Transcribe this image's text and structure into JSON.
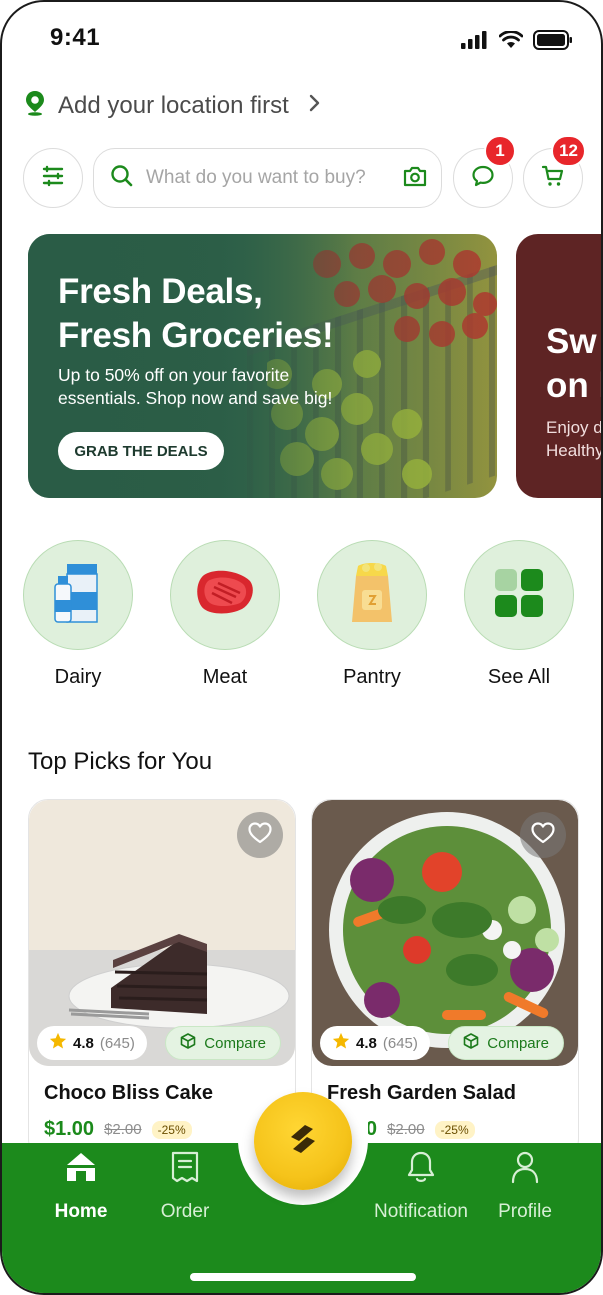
{
  "status_bar": {
    "time": "9:41"
  },
  "location": {
    "label": "Add your location first"
  },
  "search": {
    "placeholder": "What do you want to buy?"
  },
  "header": {
    "messages_badge": "1",
    "cart_badge": "12"
  },
  "banners": [
    {
      "title_line1": "Fresh Deals,",
      "title_line2": "Fresh Groceries!",
      "subtitle_line1": "Up to 50% off on your favorite",
      "subtitle_line2": "essentials. Shop now and save big!",
      "cta": "GRAB THE DEALS"
    },
    {
      "title_line1": "Sw",
      "title_line2": "on l",
      "subtitle_line1": "Enjoy d",
      "subtitle_line2": "Healthy"
    }
  ],
  "categories": [
    {
      "label": "Dairy",
      "icon": "milk-carton-icon"
    },
    {
      "label": "Meat",
      "icon": "steak-icon"
    },
    {
      "label": "Pantry",
      "icon": "flour-bag-icon"
    },
    {
      "label": "See All",
      "icon": "grid-icon"
    }
  ],
  "section_title": "Top Picks for You",
  "products": [
    {
      "name": "Choco Bliss Cake",
      "rating": "4.8",
      "rating_count": "(645)",
      "compare_label": "Compare",
      "price": "$1.00",
      "old_price": "$2.00",
      "discount": "-25%"
    },
    {
      "name": "Fresh Garden Salad",
      "rating": "4.8",
      "rating_count": "(645)",
      "compare_label": "Compare",
      "price": "$1.00",
      "old_price": "$2.00",
      "discount": "-25%"
    }
  ],
  "nav": {
    "home": "Home",
    "order": "Order",
    "notification": "Notification",
    "profile": "Profile"
  },
  "colors": {
    "brand_green": "#1c8a1c",
    "badge_red": "#e8262b",
    "fab_yellow": "#f5c31a",
    "banner_green": "#2e5f48",
    "banner_maroon": "#5e2424"
  }
}
